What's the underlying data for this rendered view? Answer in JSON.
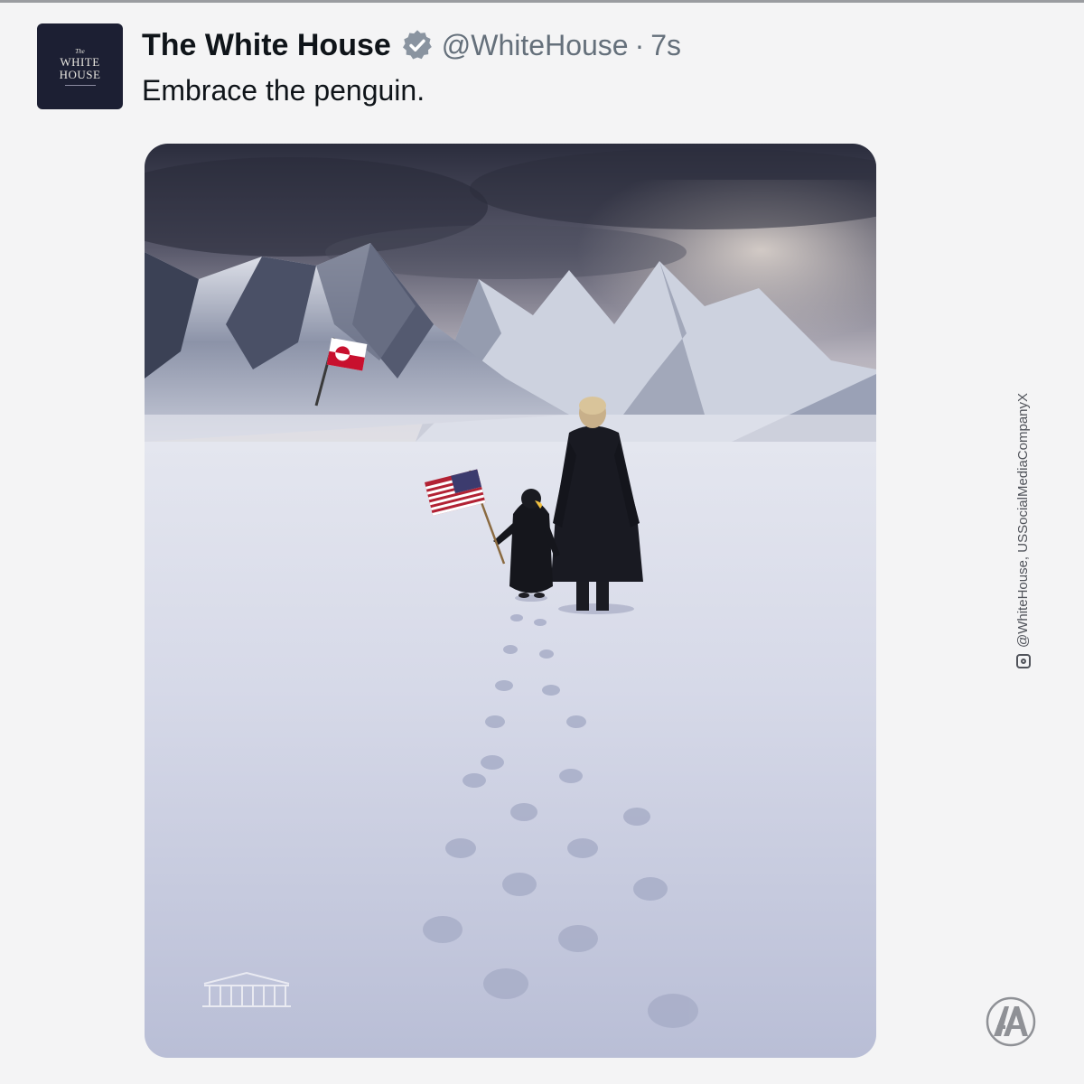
{
  "tweet": {
    "avatar": {
      "line1": "The",
      "line2": "WHITE",
      "line3": "HOUSE"
    },
    "display_name": "The White House",
    "verified_icon": "verified-badge-icon",
    "handle": "@WhiteHouse",
    "separator": "·",
    "timestamp": "7s",
    "text": "Embrace the penguin."
  },
  "media": {
    "watermark_icon": "white-house-building-icon"
  },
  "overlay": {
    "credit_icon": "instagram-icon",
    "credit": "@WhiteHouse, USSocialMediaCompanyX",
    "agency_logo": "aa-logo-icon"
  },
  "colors": {
    "background": "#f4f4f5",
    "text_primary": "#0f1419",
    "text_secondary": "#65707b",
    "verified_badge": "#8a94a0",
    "avatar_bg": "#1c1f33"
  }
}
